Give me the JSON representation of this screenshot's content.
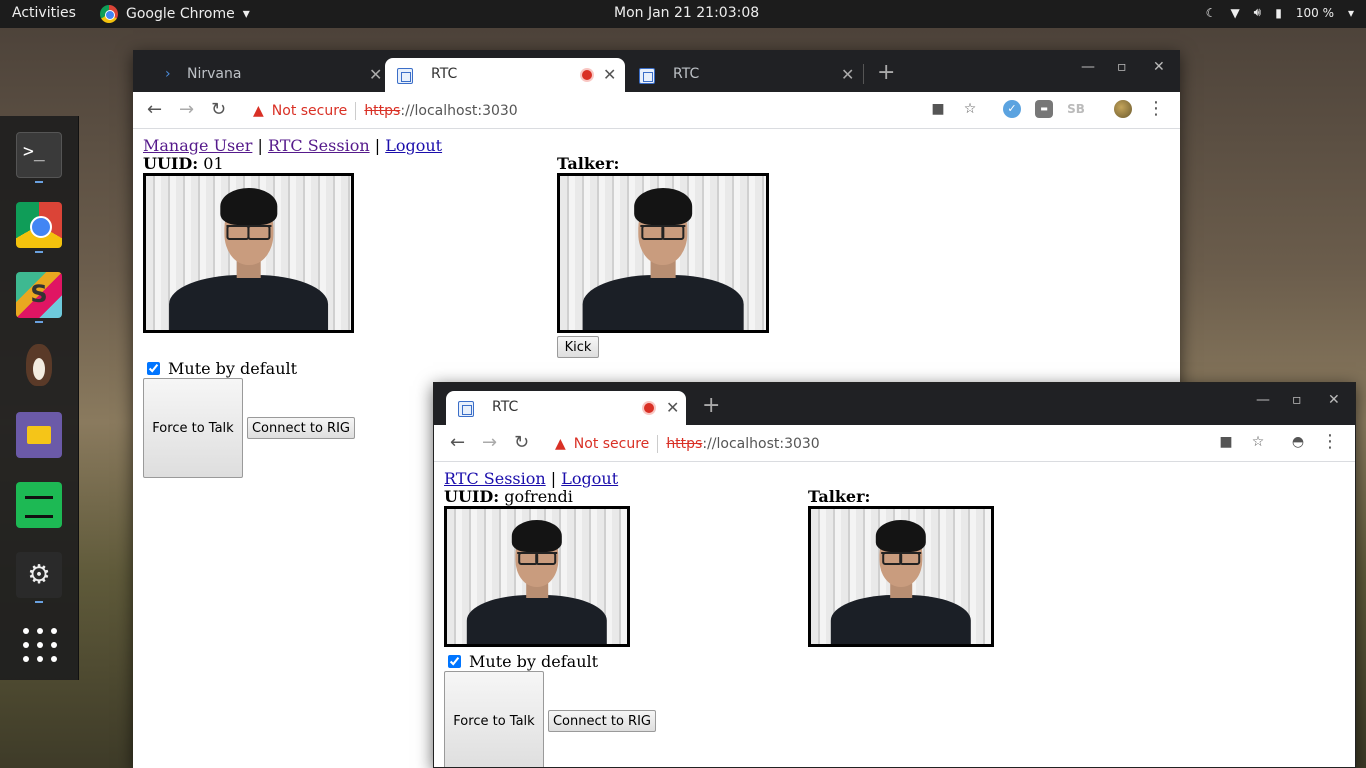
{
  "topbar": {
    "activities": "Activities",
    "app_name": "Google Chrome",
    "app_menu_arrow": "chevron-down-icon",
    "clock": "Mon Jan 21  21:03:08",
    "battery": "100 %"
  },
  "dock": {
    "items": [
      "terminal-icon",
      "chrome-icon",
      "slack-icon",
      "bird-icon",
      "files-icon",
      "spotify-icon",
      "steam-icon",
      "app-grid-icon"
    ]
  },
  "window1": {
    "tabs": [
      {
        "title": "Nirvana"
      },
      {
        "title": "RTC"
      },
      {
        "title": "RTC"
      }
    ],
    "url": {
      "warning": "Not secure",
      "scheme": "https",
      "rest": "://localhost:3030"
    },
    "page": {
      "nav": {
        "manage_user": "Manage User",
        "rtc_session": "RTC Session",
        "logout": "Logout",
        "sep": "|"
      },
      "uuid_label": "UUID:",
      "uuid_value": " 01",
      "talker_label": "Talker:",
      "kick": "Kick",
      "mute_label": "Mute by default",
      "mute_checked": true,
      "force_to_talk": "Force to Talk",
      "connect_to_rig": "Connect to RIG"
    }
  },
  "window2": {
    "tabs": [
      {
        "title": "RTC"
      }
    ],
    "url": {
      "warning": "Not secure",
      "scheme": "https",
      "rest": "://localhost:3030"
    },
    "page": {
      "nav": {
        "rtc_session": "RTC Session",
        "logout": "Logout",
        "sep": "|"
      },
      "uuid_label": "UUID:",
      "uuid_value": " gofrendi",
      "talker_label": "Talker:",
      "mute_label": "Mute by default",
      "mute_checked": true,
      "force_to_talk": "Force to Talk",
      "connect_to_rig": "Connect to RIG"
    }
  }
}
